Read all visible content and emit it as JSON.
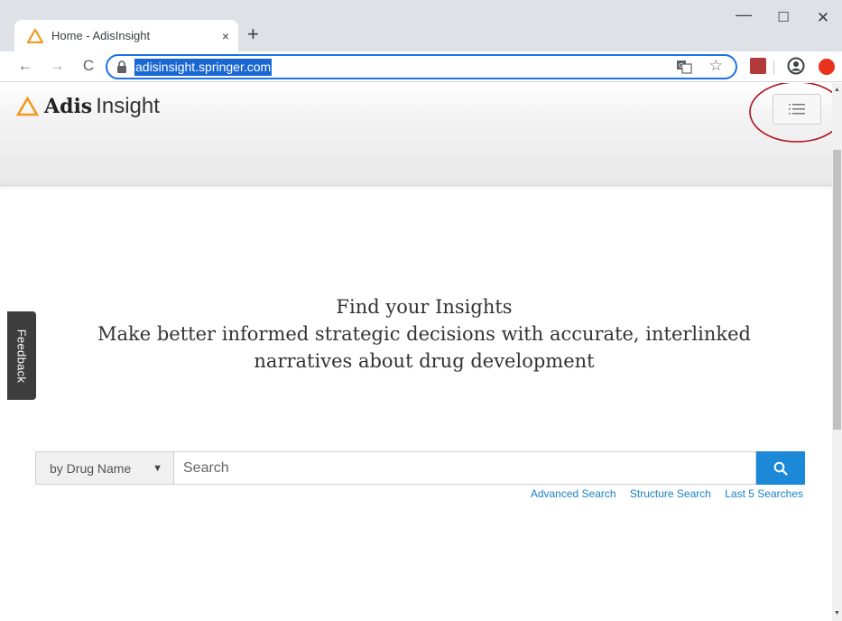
{
  "browser": {
    "tab_title": "Home - AdisInsight",
    "tab_close": "×",
    "new_tab": "+",
    "url": "adisinsight.springer.com",
    "win_minimize": "—",
    "win_maximize": "☐",
    "win_close": "✕",
    "nav_back": "←",
    "nav_forward": "→",
    "nav_reload": "C",
    "bookmark_star": "☆"
  },
  "site": {
    "logo_primary": "Adis",
    "logo_secondary": "Insight",
    "brand_color": "#f39a1e",
    "menu_icon": "list-menu-icon",
    "annotation_color": "#b0121e"
  },
  "feedback": {
    "label": "Feedback"
  },
  "hero": {
    "title": "Find your Insights",
    "subtitle_line1": "Make better informed strategic decisions with accurate, interlinked",
    "subtitle_line2": "narratives about drug development"
  },
  "search": {
    "scope_selected": "by Drug Name",
    "scope_arrow": "▼",
    "placeholder": "Search",
    "button_color": "#1b88d8",
    "links": [
      "Advanced Search",
      "Structure Search",
      "Last 5 Searches"
    ]
  },
  "scrollbar": {
    "up": "▲",
    "down": "▼"
  }
}
